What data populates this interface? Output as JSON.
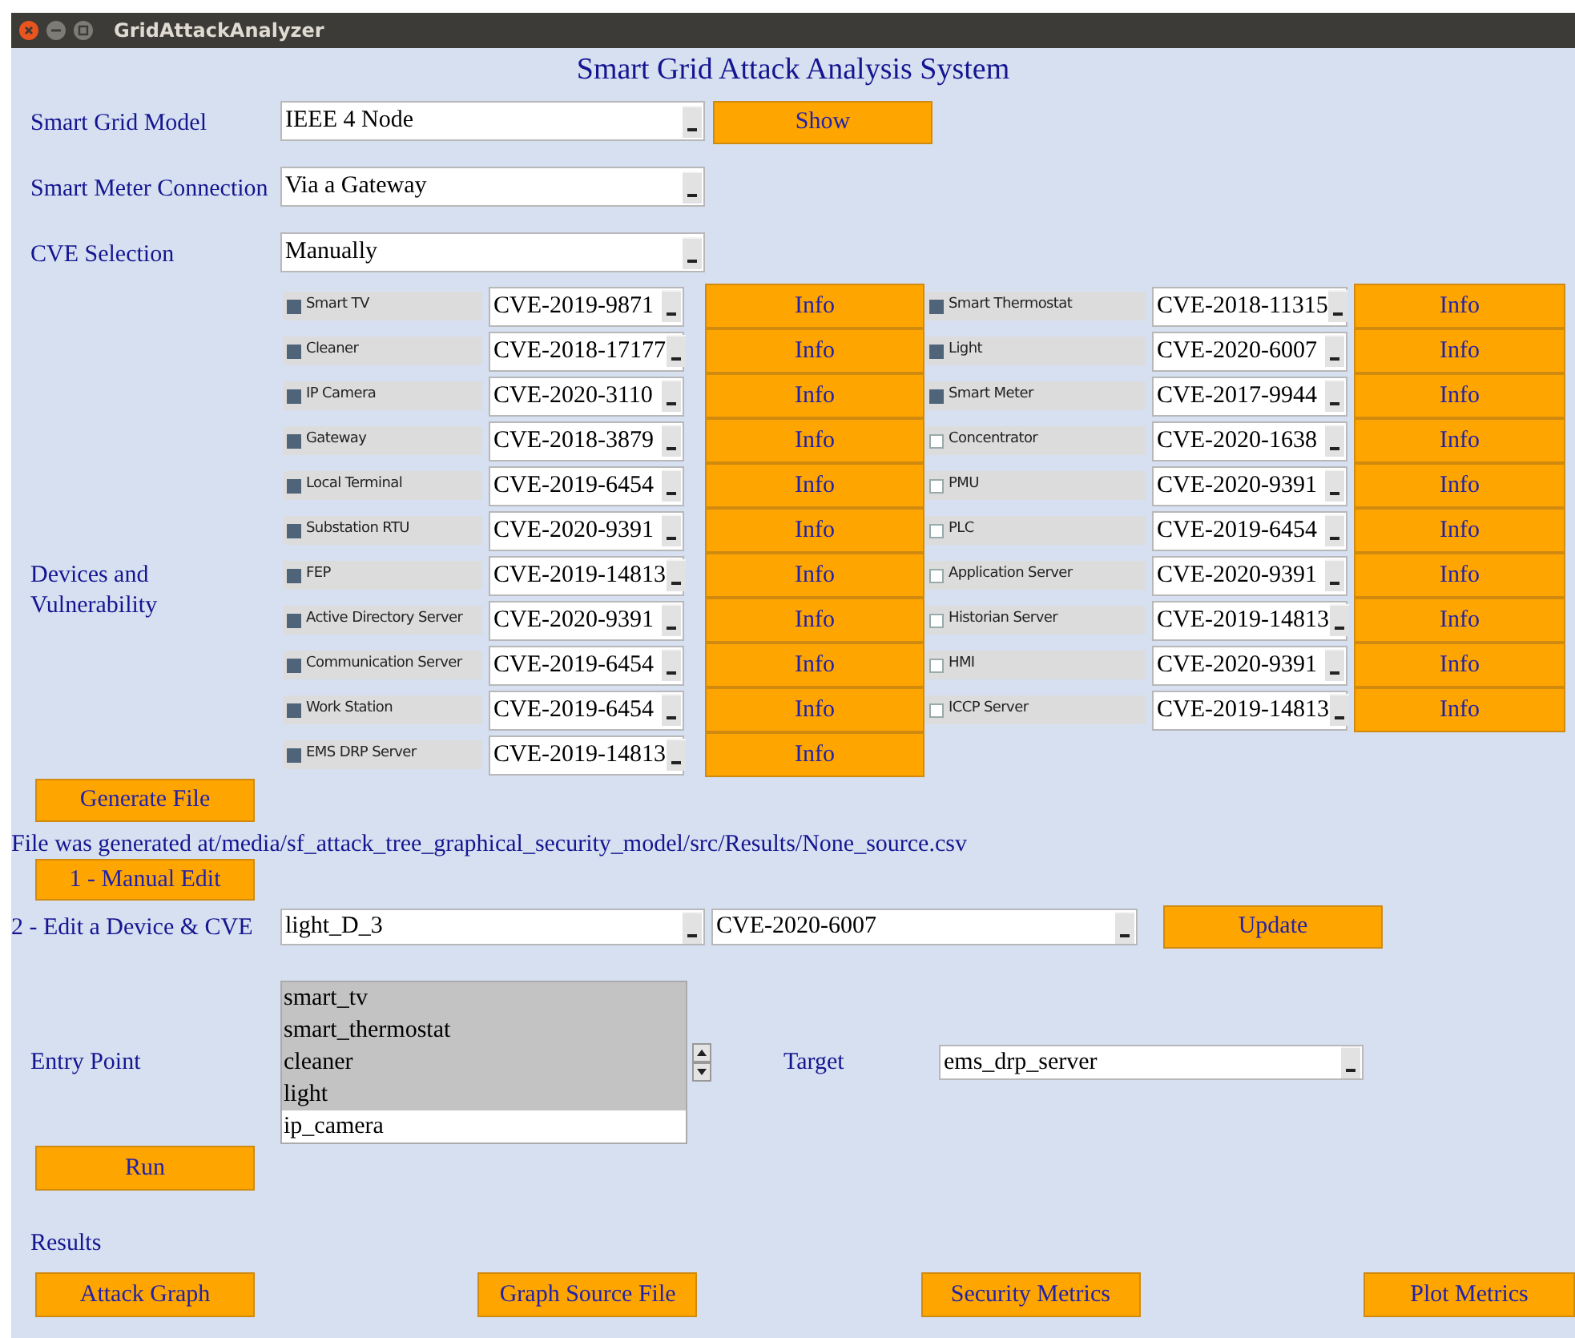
{
  "window": {
    "title": "GridAttackAnalyzer"
  },
  "heading": "Smart Grid Attack Analysis System",
  "settings": [
    {
      "label": "Smart Grid Model",
      "value": "IEEE 4 Node",
      "button": "Show"
    },
    {
      "label": "Smart Meter Connection",
      "value": "Via a Gateway"
    },
    {
      "label": "CVE Selection",
      "value": "Manually"
    }
  ],
  "devices": {
    "label": "Devices and Vulnerability",
    "left_column": [
      {
        "name": "Smart TV",
        "checked": true,
        "cve": "CVE-2019-9871",
        "button": "Info"
      },
      {
        "name": "Cleaner",
        "checked": true,
        "cve": "CVE-2018-17177",
        "button": "Info"
      },
      {
        "name": "IP Camera",
        "checked": true,
        "cve": "CVE-2020-3110",
        "button": "Info"
      },
      {
        "name": "Gateway",
        "checked": true,
        "cve": "CVE-2018-3879",
        "button": "Info"
      },
      {
        "name": "Local Terminal",
        "checked": true,
        "cve": "CVE-2019-6454",
        "button": "Info"
      },
      {
        "name": "Substation RTU",
        "checked": true,
        "cve": "CVE-2020-9391",
        "button": "Info"
      },
      {
        "name": "FEP",
        "checked": true,
        "cve": "CVE-2019-14813",
        "button": "Info"
      },
      {
        "name": "Active Directory Server",
        "checked": true,
        "cve": "CVE-2020-9391",
        "button": "Info"
      },
      {
        "name": "Communication Server",
        "checked": true,
        "cve": "CVE-2019-6454",
        "button": "Info"
      },
      {
        "name": "Work Station",
        "checked": true,
        "cve": "CVE-2019-6454",
        "button": "Info"
      },
      {
        "name": "EMS DRP Server",
        "checked": true,
        "cve": "CVE-2019-14813",
        "button": "Info"
      }
    ],
    "right_column": [
      {
        "name": "Smart Thermostat",
        "checked": true,
        "cve": "CVE-2018-11315",
        "button": "Info"
      },
      {
        "name": "Light",
        "checked": true,
        "cve": "CVE-2020-6007",
        "button": "Info"
      },
      {
        "name": "Smart Meter",
        "checked": true,
        "cve": "CVE-2017-9944",
        "button": "Info"
      },
      {
        "name": "Concentrator",
        "checked": false,
        "cve": "CVE-2020-1638",
        "button": "Info"
      },
      {
        "name": "PMU",
        "checked": false,
        "cve": "CVE-2020-9391",
        "button": "Info"
      },
      {
        "name": "PLC",
        "checked": false,
        "cve": "CVE-2019-6454",
        "button": "Info"
      },
      {
        "name": "Application Server",
        "checked": false,
        "cve": "CVE-2020-9391",
        "button": "Info"
      },
      {
        "name": "Historian Server",
        "checked": false,
        "cve": "CVE-2019-14813",
        "button": "Info"
      },
      {
        "name": "HMI",
        "checked": false,
        "cve": "CVE-2020-9391",
        "button": "Info"
      },
      {
        "name": "ICCP Server",
        "checked": false,
        "cve": "CVE-2019-14813",
        "button": "Info"
      }
    ]
  },
  "generate_button": "Generate File",
  "file_message": "File was generated at/media/sf_attack_tree_graphical_security_model/src/Results/None_source.csv",
  "manual_edit_button": "1 - Manual Edit",
  "edit": {
    "label": "2 - Edit a Device & CVE",
    "device": "light_D_3",
    "cve": "CVE-2020-6007",
    "button": "Update"
  },
  "entry_point": {
    "label": "Entry Point",
    "items": [
      {
        "label": "smart_tv",
        "selected": true
      },
      {
        "label": "smart_thermostat",
        "selected": true
      },
      {
        "label": "cleaner",
        "selected": true
      },
      {
        "label": "light",
        "selected": true
      },
      {
        "label": "ip_camera",
        "selected": false
      }
    ]
  },
  "target": {
    "label": "Target",
    "value": "ems_drp_server"
  },
  "run_button": "Run",
  "results": {
    "label": "Results",
    "buttons": [
      "Attack Graph",
      "Graph Source File",
      "Security Metrics",
      "Plot Metrics"
    ]
  }
}
